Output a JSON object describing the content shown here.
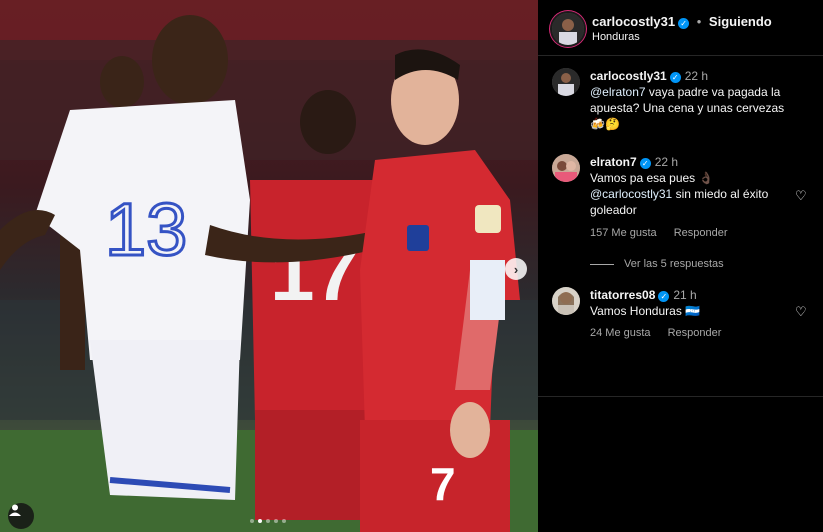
{
  "post": {
    "username": "carlocostly31",
    "following_label": "Siguiendo",
    "location": "Honduras",
    "carousel_dots": 5,
    "carousel_active_index": 1
  },
  "comments": [
    {
      "username": "carlocostly31",
      "time": "22 h",
      "mention": "@elraton7",
      "text": "vaya padre va pagada la apuesta? Una cena y unas cervezas 🍻🤔"
    },
    {
      "username": "elraton7",
      "time": "22 h",
      "text_before": "Vamos pa esa pues 👌🏿",
      "mention": "@carlocostly31",
      "text_after": "sin miedo al éxito goleador",
      "likes": "157 Me gusta",
      "reply_label": "Responder",
      "view_replies": "Ver las 5 respuestas"
    },
    {
      "username": "titatorres08",
      "time": "21 h",
      "text": "Vamos Honduras 🇭🇳",
      "likes": "24 Me gusta",
      "reply_label": "Responder"
    }
  ],
  "photo": {
    "left_jersey_number": "13",
    "middle_jersey_number": "17",
    "right_jersey_number": "7"
  },
  "colors": {
    "verified": "#0095f6",
    "panel_bg": "#000000",
    "muted_text": "#a8a8a8"
  }
}
